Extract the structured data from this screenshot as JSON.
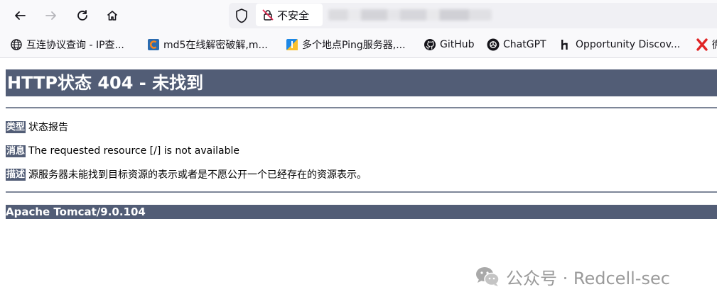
{
  "browser": {
    "security_label": "不安全",
    "bookmarks": [
      {
        "label": "互连协议查询 - IP查...",
        "icon": "globe-icon"
      },
      {
        "label": "md5在线解密破解,m...",
        "icon": "cmd5-icon"
      },
      {
        "label": "多个地点Ping服务器,...",
        "icon": "ping-icon"
      },
      {
        "label": "GitHub",
        "icon": "github-icon"
      },
      {
        "label": "ChatGPT",
        "icon": "chatgpt-icon"
      },
      {
        "label": "Opportunity Discov...",
        "icon": "hackerone-icon"
      },
      {
        "label": "微",
        "icon": "x-icon"
      }
    ]
  },
  "page": {
    "title": "HTTP状态 404 - 未找到",
    "rows": [
      {
        "tag": "类型",
        "text": "状态报告"
      },
      {
        "tag": "消息",
        "text": "The requested resource [/] is not available"
      },
      {
        "tag": "描述",
        "text": "源服务器未能找到目标资源的表示或者是不愿公开一个已经存在的资源表示。"
      }
    ],
    "footer": "Apache Tomcat/9.0.104",
    "accent_color": "#525d76"
  },
  "watermark": {
    "text": "公众号 · Redcell-sec"
  }
}
